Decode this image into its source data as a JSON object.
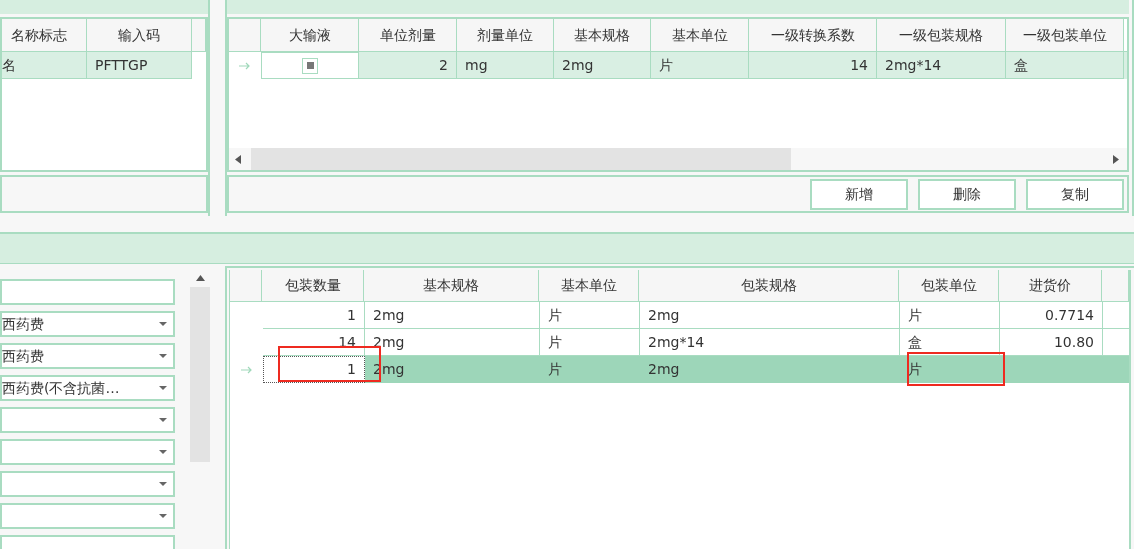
{
  "name_grid": {
    "columns": [
      "名称标志",
      "输入码"
    ],
    "rows": [
      {
        "cells": [
          "名",
          "PFTTGP"
        ],
        "selected": true
      }
    ]
  },
  "spec_grid": {
    "columns": [
      "大输液",
      "单位剂量",
      "剂量单位",
      "基本规格",
      "基本单位",
      "一级转换系数",
      "一级包装规格",
      "一级包装单位"
    ],
    "rows": [
      {
        "current": true,
        "selected": true,
        "large_infusion_checked": true,
        "cells": [
          "",
          "2",
          "mg",
          "2mg",
          "片",
          "14",
          "2mg*14",
          "盒"
        ]
      }
    ]
  },
  "spec_buttons": [
    "新增",
    "删除",
    "复制"
  ],
  "form_fields": [
    {
      "kind": "text"
    },
    {
      "kind": "dropdown",
      "value": "西药费"
    },
    {
      "kind": "dropdown",
      "value": "西药费"
    },
    {
      "kind": "dropdown",
      "value": "西药费(不含抗菌…"
    },
    {
      "kind": "dropdown"
    },
    {
      "kind": "dropdown"
    },
    {
      "kind": "dropdown"
    },
    {
      "kind": "dropdown"
    },
    {
      "kind": "text"
    }
  ],
  "package_grid": {
    "columns": [
      "包装数量",
      "基本规格",
      "基本单位",
      "包装规格",
      "包装单位",
      "进货价"
    ],
    "rows": [
      {
        "current": false,
        "selected": false,
        "cells": [
          "1",
          "2mg",
          "片",
          "2mg",
          "片",
          "0.7714"
        ],
        "marked_cells": [
          false,
          false,
          false,
          false,
          false,
          false
        ]
      },
      {
        "current": false,
        "selected": false,
        "cells": [
          "14",
          "2mg",
          "片",
          "2mg*14",
          "盒",
          "10.80"
        ],
        "marked_cells": [
          false,
          false,
          false,
          false,
          false,
          false
        ]
      },
      {
        "current": true,
        "selected": true,
        "cells": [
          "1",
          "2mg",
          "片",
          "2mg",
          "片"
        ],
        "marked_cells": [
          true,
          false,
          false,
          false,
          true,
          false
        ]
      }
    ]
  }
}
